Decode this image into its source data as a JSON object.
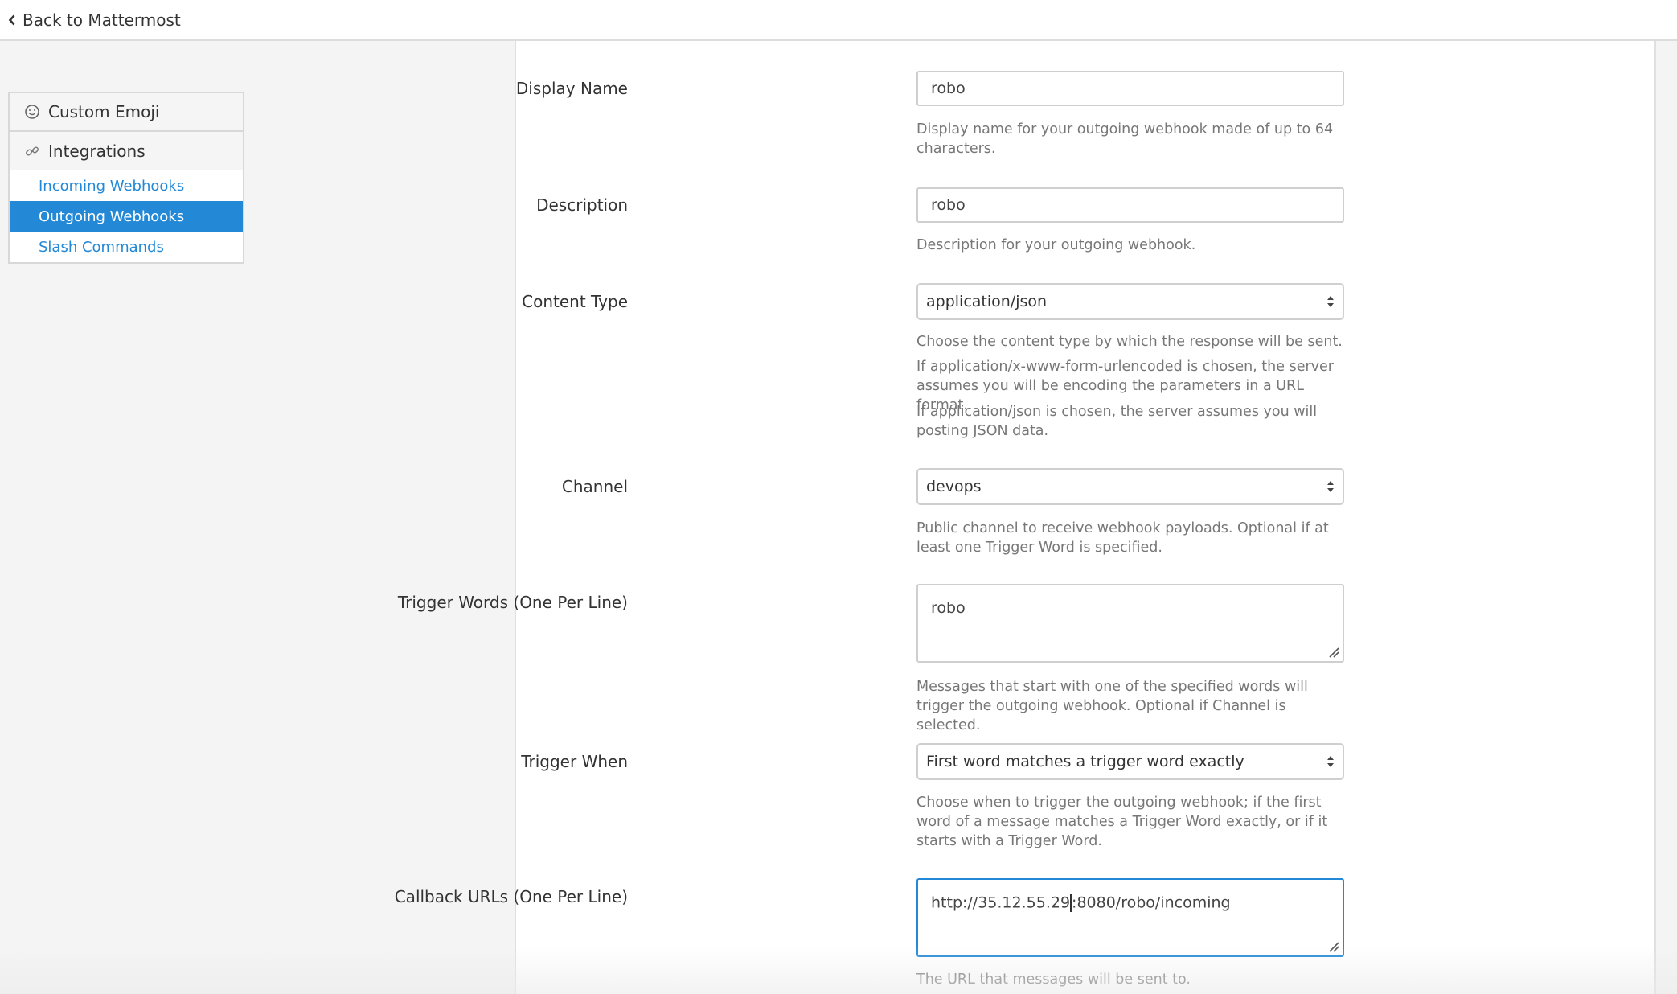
{
  "topbar": {
    "back_label": "Back to Mattermost"
  },
  "sidebar": {
    "sections": [
      {
        "label": "Custom Emoji",
        "icon": "smiley-icon"
      },
      {
        "label": "Integrations",
        "icon": "link-icon"
      }
    ],
    "items": [
      {
        "label": "Incoming Webhooks"
      },
      {
        "label": "Outgoing Webhooks",
        "active": true
      },
      {
        "label": "Slash Commands"
      }
    ]
  },
  "form": {
    "display_name": {
      "label": "Display Name",
      "value": "robo",
      "help": "Display name for your outgoing webhook made of up to 64 characters."
    },
    "description": {
      "label": "Description",
      "value": "robo",
      "help": "Description for your outgoing webhook."
    },
    "content_type": {
      "label": "Content Type",
      "value": "application/json",
      "help1": "Choose the content type by which the response will be sent.",
      "help2": "If application/x-www-form-urlencoded is chosen, the server assumes you will be encoding the parameters in a URL format.",
      "help3": "If application/json is chosen, the server assumes you will posting JSON data."
    },
    "channel": {
      "label": "Channel",
      "value": "devops",
      "help": "Public channel to receive webhook payloads. Optional if at least one Trigger Word is specified."
    },
    "trigger_words": {
      "label": "Trigger Words (One Per Line)",
      "value": "robo",
      "help": "Messages that start with one of the specified words will trigger the outgoing webhook. Optional if Channel is selected."
    },
    "trigger_when": {
      "label": "Trigger When",
      "value": "First word matches a trigger word exactly",
      "help": "Choose when to trigger the outgoing webhook; if the first word of a message matches a Trigger Word exactly, or if it starts with a Trigger Word."
    },
    "callback_urls": {
      "label": "Callback URLs (One Per Line)",
      "value_before_caret": "http://35.12.55.29",
      "value_after_caret": ":8080/robo/incoming",
      "help": "The URL that messages will be sent to."
    }
  },
  "colors": {
    "accent": "#2389d7",
    "help_text": "#777777",
    "border": "#cfcfcf"
  }
}
